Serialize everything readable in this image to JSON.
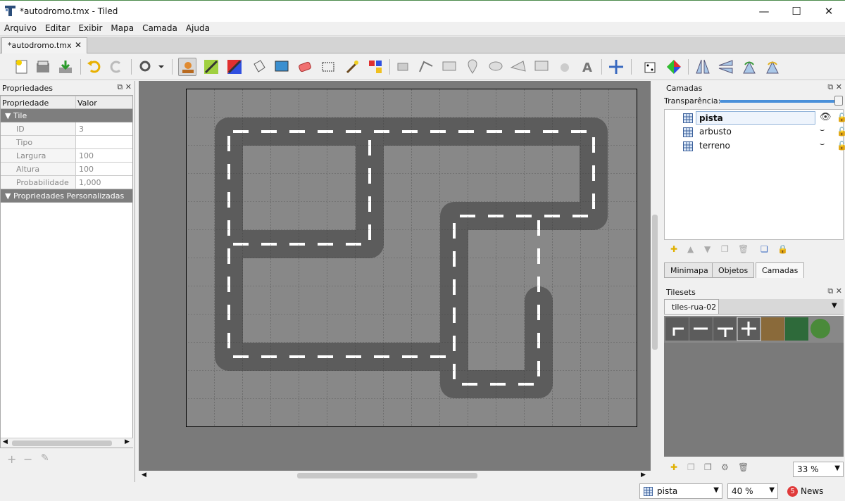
{
  "window": {
    "title": "*autodromo.tmx - Tiled",
    "minimize": "—",
    "maximize": "☐",
    "close": "✕"
  },
  "menu": [
    "Arquivo",
    "Editar",
    "Exibir",
    "Mapa",
    "Camada",
    "Ajuda"
  ],
  "doc_tab": {
    "label": "*autodromo.tmx",
    "close": "✕"
  },
  "toolbar_icons": [
    "new-map-icon",
    "open-file-icon",
    "save-icon",
    "undo-icon",
    "redo-icon",
    "commands-icon",
    "stamp-brush-icon",
    "terrain-brush-icon",
    "wang-brush-icon",
    "bucket-fill-icon",
    "shape-fill-icon",
    "eraser-icon",
    "rect-select-icon",
    "magic-wand-icon",
    "select-same-tile-icon",
    "select-objects-icon",
    "edit-polygons-icon",
    "insert-rectangle-icon",
    "insert-point-icon",
    "insert-ellipse-icon",
    "insert-polygon-icon",
    "insert-tile-icon",
    "insert-template-icon",
    "insert-text-icon",
    "move-icon",
    "random-mode-icon",
    "wang-fill-icon",
    "flip-horizontal-icon",
    "flip-vertical-icon",
    "rotate-left-icon",
    "rotate-right-icon"
  ],
  "properties": {
    "title": "Propriedades",
    "col_property": "Propriedade",
    "col_value": "Valor",
    "group_tile": "Tile",
    "rows": [
      {
        "k": "ID",
        "v": "3"
      },
      {
        "k": "Tipo",
        "v": ""
      },
      {
        "k": "Largura",
        "v": "100"
      },
      {
        "k": "Altura",
        "v": "100"
      },
      {
        "k": "Probabilidade",
        "v": "1,000"
      }
    ],
    "group_custom": "Propriedades Personalizadas",
    "add": "+",
    "remove": "−",
    "rename": "✎"
  },
  "layers": {
    "title": "Camadas",
    "opacity_label": "Transparência:",
    "opacity": 1.0,
    "items": [
      {
        "name": "pista",
        "visible": true,
        "selected": true
      },
      {
        "name": "arbusto",
        "visible": false
      },
      {
        "name": "terreno",
        "visible": false
      }
    ],
    "tabs": [
      "Minimapa",
      "Objetos",
      "Camadas"
    ]
  },
  "tilesets": {
    "title": "Tilesets",
    "active": "tiles-rua-02",
    "zoom": "33 %"
  },
  "status": {
    "layer": "pista",
    "zoom": "40 %",
    "news_count": "5",
    "news": "News"
  }
}
